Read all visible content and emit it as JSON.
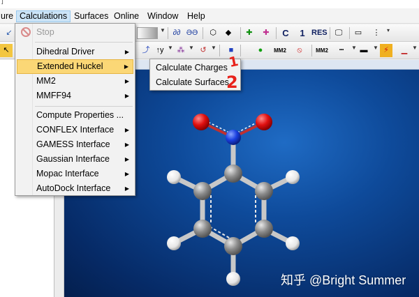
{
  "top_stub_mark": "]",
  "menubar": {
    "items": [
      "ure",
      "Calculations",
      "Surfaces",
      "Online",
      "Window",
      "Help"
    ],
    "active_index": 1
  },
  "toolbar": {
    "bond_label": "MM2",
    "c_label": "C",
    "one_label": "1",
    "res_label": "RES",
    "mm2_label": "MM2"
  },
  "calculations_menu": {
    "stop": "Stop",
    "items": [
      {
        "label": "Dihedral Driver",
        "submenu": true
      },
      {
        "label": "Extended Huckel",
        "submenu": true,
        "highlighted": true
      },
      {
        "label": "MM2",
        "submenu": true
      },
      {
        "label": "MMFF94",
        "submenu": true
      },
      {
        "label": "Compute Properties ...",
        "submenu": false
      },
      {
        "label": "CONFLEX Interface",
        "submenu": true
      },
      {
        "label": "GAMESS Interface",
        "submenu": true
      },
      {
        "label": "Gaussian Interface",
        "submenu": true
      },
      {
        "label": "Mopac Interface",
        "submenu": true
      },
      {
        "label": "AutoDock Interface",
        "submenu": true
      }
    ]
  },
  "extended_huckel_submenu": {
    "items": [
      "Calculate Charges",
      "Calculate Surfaces"
    ]
  },
  "annotations": [
    "1",
    "2"
  ],
  "watermark": "知乎 @Bright Summer",
  "colors": {
    "menu_highlight": "#fbd776",
    "canvas_blue": "#0e4a9a",
    "annotation_red": "#e8221b",
    "oxygen": "#e01010",
    "nitrogen": "#1a3fe0",
    "carbon": "#8a8a8a",
    "hydrogen": "#f4f4f4"
  }
}
